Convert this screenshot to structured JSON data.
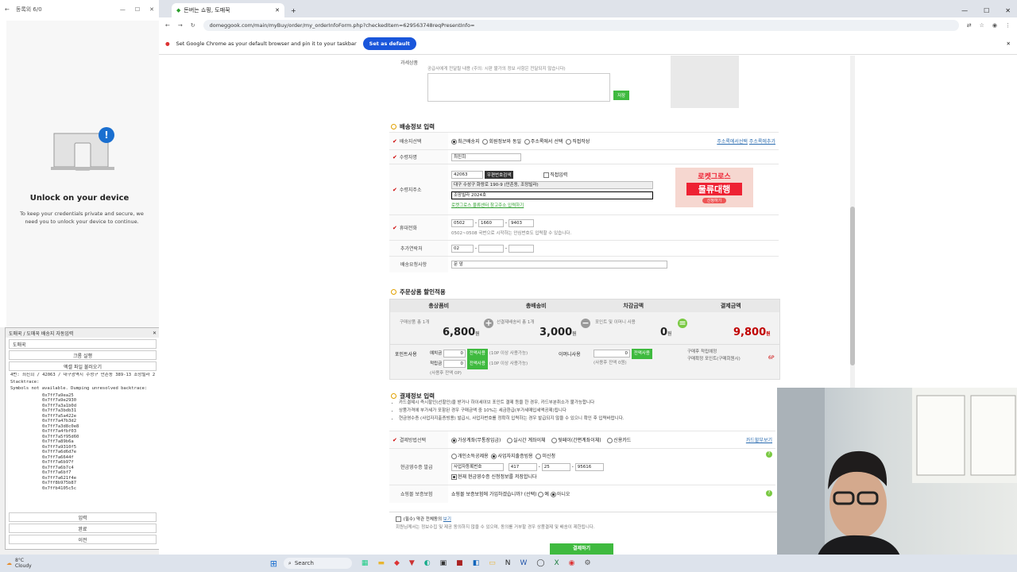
{
  "auth_window": {
    "title": "동록외 6/0",
    "heading": "Unlock on your device",
    "description": "To keep your credentials private and secure, we need you to unlock your device to continue."
  },
  "debug_window": {
    "title": "도매꾹 / 도매꾹 배송지 자동입력",
    "input_value": "도매꾹",
    "status": "크롬 실행",
    "line2": "엑셀 파일 불러오기",
    "address": "4번: 최진희 / 42063 / 대구광역시 수성구 만촌동 389-13 조망빌라 2024",
    "log_header": "Stacktrace:",
    "log_msg": "Symbols not available. Dumping unresolved backtrace:",
    "log_lines": [
      "0x7ff7a9ea25",
      "0x7ff7a9e2930",
      "0x7ff7a3a1b0d",
      "0x7ff7a3bdb31",
      "0x7ff7a5a422e",
      "0x7ff7a47b3d2",
      "0x7ff7a3d8c0e8",
      "0x7ff7a4fbf03",
      "0x7ff7a5f95d60",
      "0x7ff7a89b6a",
      "0x7ff7a9310f5",
      "0x7ff7a6d6d7e",
      "0x7ff7a6644f",
      "0x7ff7a6b97f",
      "0x7ff7a6b7c4",
      "0x7ff7a6bf7",
      "0x7ff7a621f4e",
      "0x7ff8b975b87",
      "0x7ffb4105c5c"
    ],
    "btn_input": "입력",
    "btn_done": "완료",
    "btn_prev": "이전"
  },
  "browser": {
    "tab_title": "돈버는 쇼핑, 도매꾹",
    "url": "domeggook.com/main/myBuy/order/my_orderInfoForm.php?checkedItem=629563748reqPresentInfo=",
    "infobar_text": "Set Google Chrome as your default browser and pin it to your taskbar",
    "infobar_button": "Set as default"
  },
  "page": {
    "top_label": "과세상품",
    "top_note": "공급사에게 전달될 내용 (주의: 시판 불가의 정보 사항은 전달되지 않습니다)",
    "save_btn": "저장",
    "shipping_title": "배송정보 입력",
    "ship_select_label": "배송지선택",
    "ship_options": [
      "최근배송지",
      "회원정보와 동일",
      "주소록에서 선택",
      "직접작성"
    ],
    "addr_book_link": "주소록에서선택",
    "addr_add_link": "주소록에추가",
    "recipient_label": "수령자명",
    "recipient_value": "최진희",
    "address_label": "수령지주소",
    "zipcode": "42063",
    "zip_search_btn": "우편번호검색",
    "direct_input": "직접입력",
    "addr_line1": "대구 수성구 화랑로 190-9 (만촌동, 조망빌라)",
    "addr_line2": "조망빌라 2024호",
    "addr_hint": "로켓그로스 물류센터 창고주소 입력하기",
    "banner_top": "로켓그로스",
    "banner_main": "물류대행",
    "banner_btn": "신청하기",
    "phone_label": "휴대전화",
    "phone1": "0502",
    "phone2": "1660",
    "phone3": "9403",
    "phone_hint": "0502~0508 국번으로 시작하는 안심번호도 입력할 수 있습니다.",
    "extra_phone_label": "추가연락처",
    "extra_phone1": "02",
    "request_label": "배송요청사항",
    "request_value": "문 앞",
    "discount_title": "주문상품 할인적용",
    "summary_heads": [
      "총상품비",
      "총배송비",
      "차감금액",
      "결제금액"
    ],
    "goods_sub": "구매상품 총 1개",
    "goods_amount": "6,800",
    "ship_sub": "선결제배송비 총 1개",
    "ship_amount": "3,000",
    "deduct_sub": "포인트 및 이머니 사용",
    "deduct_amount": "0",
    "pay_amount": "9,800",
    "won": "원",
    "point_label": "포인트사용",
    "point_rows": [
      "예치금",
      "적립금"
    ],
    "point_value": "0",
    "use_all_btn": "전액사용",
    "point_min": "(10P 이상 사용가능)",
    "point_bal": "(사용후 잔액 0P)",
    "emoney_label": "이머니사용",
    "emoney_bal": "(사용후 잔액 0원)",
    "reward_label": "구매후 적립예정",
    "reward_sub": "구매확정 포인트(구매회원시)",
    "reward_value": "6P",
    "payment_title": "결제정보 입력",
    "payment_notes": [
      "카드결제시 즉시할인(선할인)을 받거나 하이세이브 포인트 결제 등을 한 경우, 카드부분취소가 불가능합니다",
      "상품가격에 부가세가 포함된 경우 구매금액 중 10%는 세금환급(부가세매입세액공제)됩니다",
      "현금영수증 (사업자지출증빙용) 발급시, 사업자번호를 정확히 입력하는 경우 발급되지 않을 수 있으니 확인 후 입력바랍니다."
    ],
    "paymethod_label": "결제방법선택",
    "paymethods": [
      "가상계좌(무통장입금)",
      "실시간 계좌이체",
      "뒷페이(간편계좌이체)",
      "신용카드"
    ],
    "card_benefit_link": "카드할부보기",
    "receipt_label": "현금영수증 발급",
    "receipt_options": [
      "개인소득공제용",
      "사업자지출증빙용",
      "미신청"
    ],
    "biz_no_placeholder": "사업자등록번호",
    "biz_no1": "417",
    "biz_no2": "25",
    "biz_no3": "95616",
    "save_receipt": "현재 현금영수증 신청정보를 저장합니다",
    "insurance_label": "쇼핑몰 보증보험",
    "insurance_q": "쇼핑몰 보증보험에 가입하겠습니까? (선택)",
    "insurance_yes": "예",
    "insurance_no": "아니오",
    "agree_text": "(필수) 약관 전체동의",
    "agree_link": "보기",
    "agree_note": "회원님께서는 정보수집 및 제공 동의하지 않을 수 있으며, 동의를 거부할 경우 상품결제 및 배송이 제한됩니다.",
    "submit_btn": "결제하기"
  },
  "taskbar": {
    "weather_temp": "8°C",
    "weather_desc": "Cloudy",
    "search_placeholder": "Search"
  },
  "colors": {
    "accent_green": "#3fba3f",
    "pay_red": "#c00000",
    "chrome_blue": "#1a56db"
  }
}
